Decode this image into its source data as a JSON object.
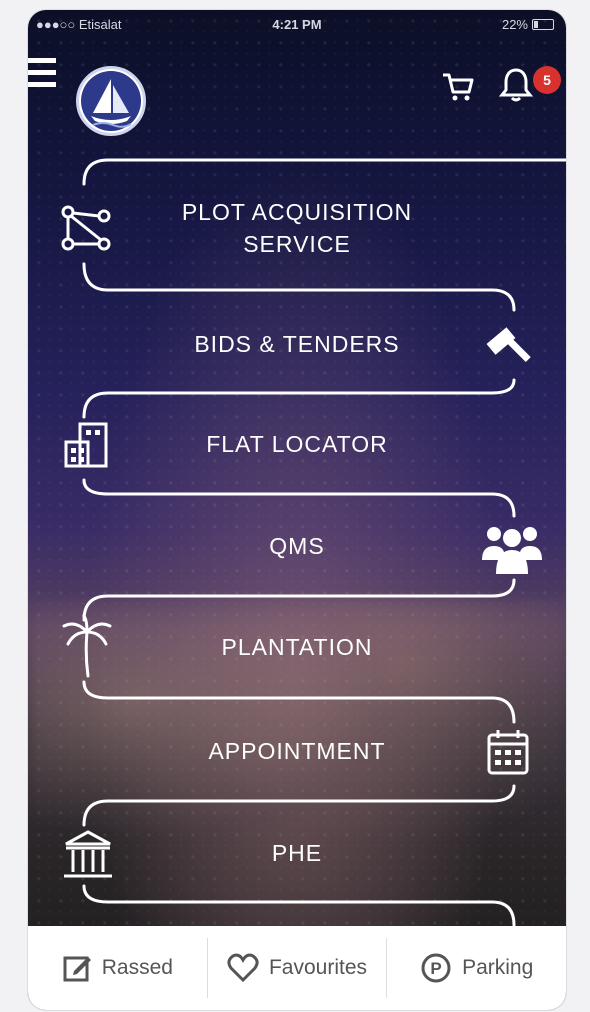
{
  "status_bar": {
    "carrier": "●●●○○ Etisalat",
    "time": "4:21 PM",
    "battery": "22%"
  },
  "header": {
    "notification_count": "5",
    "icons": [
      "menu-icon",
      "logo-emblem",
      "cart-icon",
      "bell-icon"
    ]
  },
  "menu_items": [
    {
      "label": "PLOT ACQUISITION",
      "label2": "SERVICE",
      "icon": "network-nodes-icon"
    },
    {
      "label": "BIDS & TENDERS",
      "icon": "gavel-icon"
    },
    {
      "label": "FLAT LOCATOR",
      "icon": "buildings-icon"
    },
    {
      "label": "QMS",
      "icon": "people-group-icon"
    },
    {
      "label": "PLANTATION",
      "icon": "palm-tree-icon"
    },
    {
      "label": "APPOINTMENT",
      "icon": "calendar-icon"
    },
    {
      "label": "PHE",
      "icon": "institution-icon"
    }
  ],
  "bottom_bar": [
    {
      "label": "Rassed",
      "icon": "edit-icon"
    },
    {
      "label": "Favourites",
      "icon": "heart-icon"
    },
    {
      "label": "Parking",
      "icon": "parking-icon"
    }
  ],
  "colors": {
    "badge": "#d8322e",
    "track_line": "#ffffff"
  }
}
